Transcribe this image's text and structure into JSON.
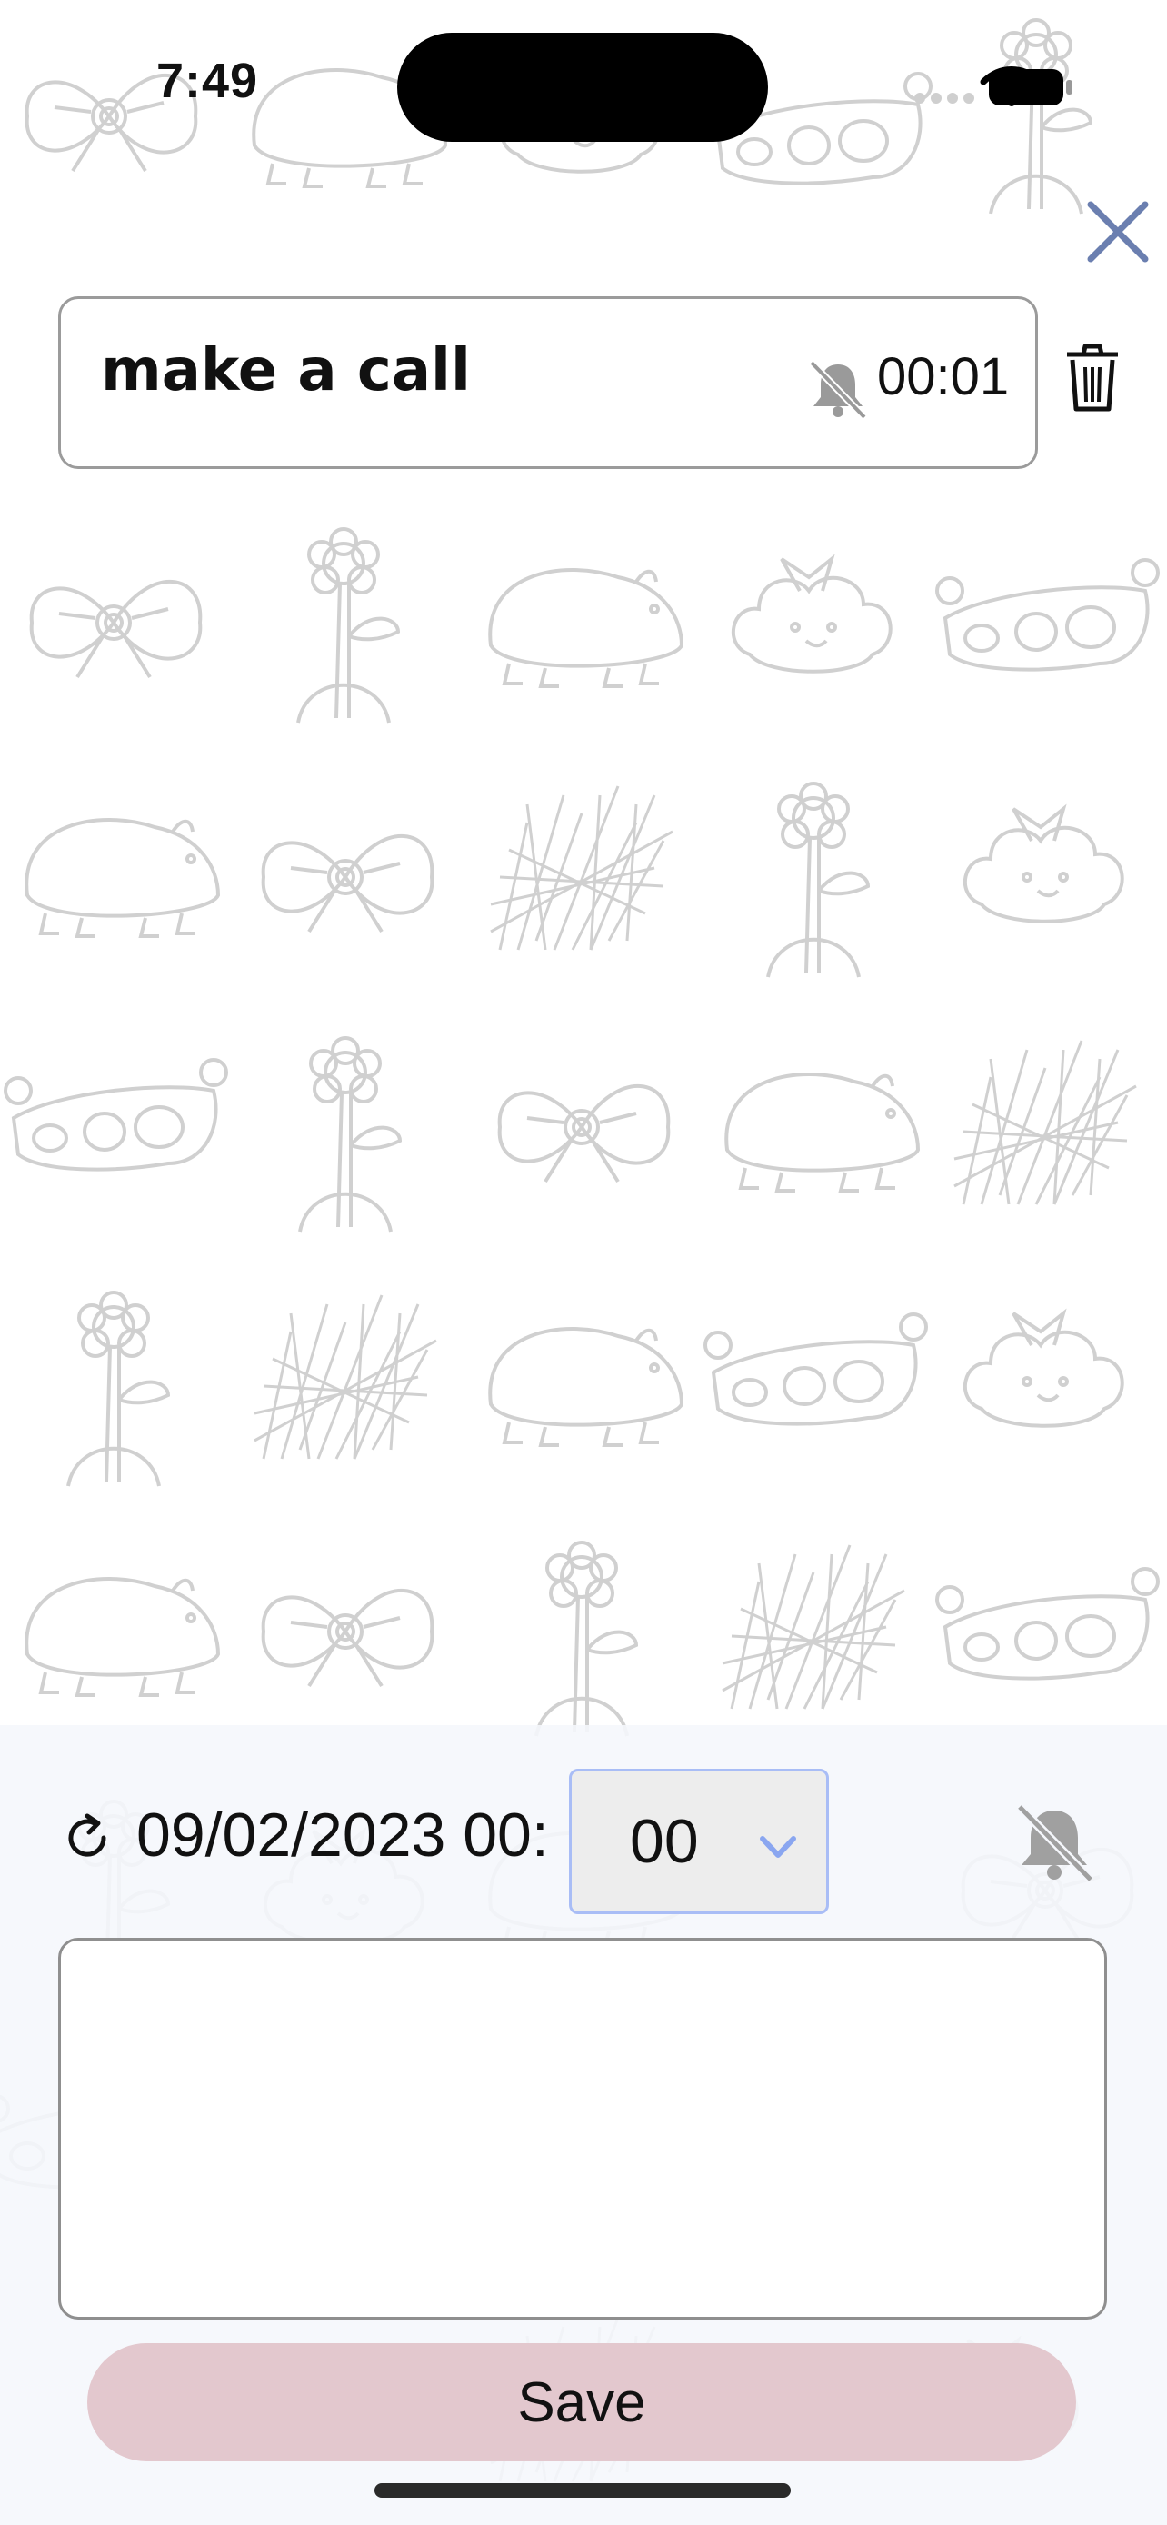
{
  "status_bar": {
    "time": "7:49"
  },
  "task": {
    "title": "make a call",
    "time": "00:01",
    "alarm_icon": "bell-slash-icon"
  },
  "editor": {
    "date_prefix": "09/02/2023 00:",
    "minute": "00",
    "note": ""
  },
  "actions": {
    "save_label": "Save",
    "close_icon": "close-icon",
    "delete_icon": "trash-icon"
  },
  "colors": {
    "close": "#6b7fb0",
    "save_bg": "#e3c8ce",
    "select_border": "#a9bdf6",
    "select_chevron": "#8aa6f0",
    "doodle": "#d0d0d0"
  }
}
